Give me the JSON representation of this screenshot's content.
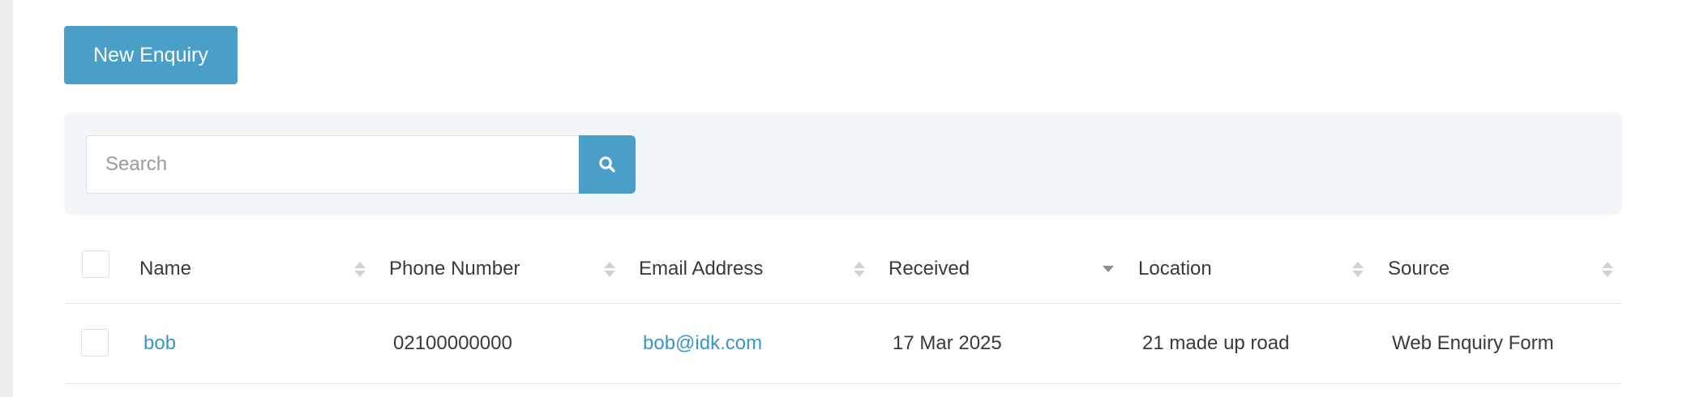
{
  "toolbar": {
    "new_label": "New Enquiry"
  },
  "search": {
    "placeholder": "Search",
    "icon": "search-icon"
  },
  "table": {
    "columns": [
      {
        "label": "Name",
        "sort": "none"
      },
      {
        "label": "Phone Number",
        "sort": "none"
      },
      {
        "label": "Email Address",
        "sort": "none"
      },
      {
        "label": "Received",
        "sort": "descending"
      },
      {
        "label": "Location",
        "sort": "none"
      },
      {
        "label": "Source",
        "sort": "none"
      }
    ],
    "rows": [
      {
        "name": "bob",
        "phone": "02100000000",
        "email": "bob@idk.com",
        "received": "17 Mar 2025",
        "location": "21 made up road",
        "source": "Web Enquiry Form"
      }
    ]
  },
  "colors": {
    "accent": "#4a9fc9",
    "link": "#3a97c2",
    "panel": "#f2f6f9"
  }
}
